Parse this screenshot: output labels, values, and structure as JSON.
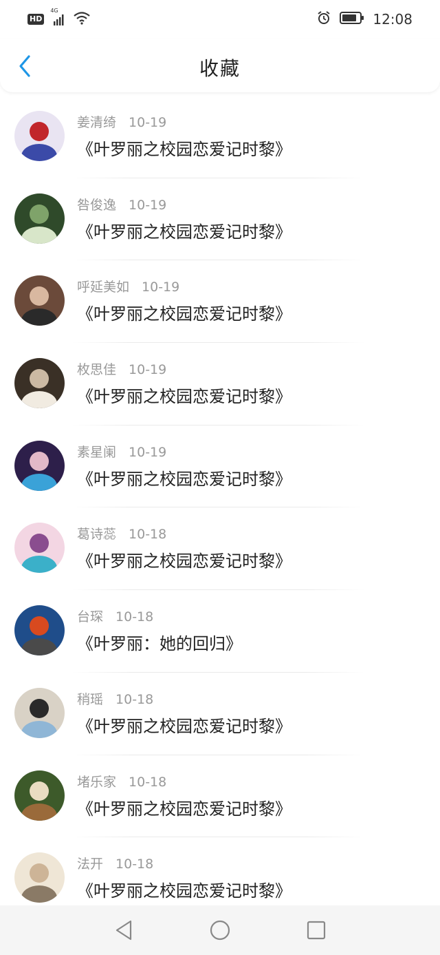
{
  "status_bar": {
    "network_badge": "HD",
    "network_type": "4G",
    "time": "12:08"
  },
  "header": {
    "title": "收藏"
  },
  "favorites": [
    {
      "user": "姜清绮",
      "date": "10-19",
      "title": "《叶罗丽之校园恋爱记时黎》",
      "avatar_colors": [
        "#e9e4f2",
        "#c1262b",
        "#3b4aa8"
      ]
    },
    {
      "user": "咎俊逸",
      "date": "10-19",
      "title": "《叶罗丽之校园恋爱记时黎》",
      "avatar_colors": [
        "#2f4a2a",
        "#7fa36a",
        "#d8e6c9"
      ]
    },
    {
      "user": "呼延美如",
      "date": "10-19",
      "title": "《叶罗丽之校园恋爱记时黎》",
      "avatar_colors": [
        "#6b4a3a",
        "#d9b8a0",
        "#2a2a2a"
      ]
    },
    {
      "user": "枚思佳",
      "date": "10-19",
      "title": "《叶罗丽之校园恋爱记时黎》",
      "avatar_colors": [
        "#3a3026",
        "#cbb9a3",
        "#f1ebe1"
      ]
    },
    {
      "user": "素星阑",
      "date": "10-19",
      "title": "《叶罗丽之校园恋爱记时黎》",
      "avatar_colors": [
        "#2d1f4a",
        "#e2b9c8",
        "#3aa2d8"
      ]
    },
    {
      "user": "葛诗蕊",
      "date": "10-18",
      "title": "《叶罗丽之校园恋爱记时黎》",
      "avatar_colors": [
        "#f3d6e3",
        "#8a4d8f",
        "#3bb0c9"
      ]
    },
    {
      "user": "台琛",
      "date": "10-18",
      "title": "《叶罗丽：她的回归》",
      "avatar_colors": [
        "#1f4d8a",
        "#d84a1f",
        "#4a4a4a"
      ]
    },
    {
      "user": "稍瑶",
      "date": "10-18",
      "title": "《叶罗丽之校园恋爱记时黎》",
      "avatar_colors": [
        "#d9d2c6",
        "#2a2a2a",
        "#8fb6d6"
      ]
    },
    {
      "user": "堵乐家",
      "date": "10-18",
      "title": "《叶罗丽之校园恋爱记时黎》",
      "avatar_colors": [
        "#3d5a2a",
        "#e9dcc1",
        "#9a6a3a"
      ]
    },
    {
      "user": "法开",
      "date": "10-18",
      "title": "《叶罗丽之校园恋爱记时黎》",
      "avatar_colors": [
        "#efe6d6",
        "#cdb497",
        "#8a7a66"
      ]
    }
  ],
  "nav": {
    "back": "back-triangle-icon",
    "home": "home-circle-icon",
    "recents": "recents-square-icon"
  },
  "colors": {
    "accent": "#1e96e6",
    "meta_text": "#999999",
    "title_text": "#222222"
  }
}
